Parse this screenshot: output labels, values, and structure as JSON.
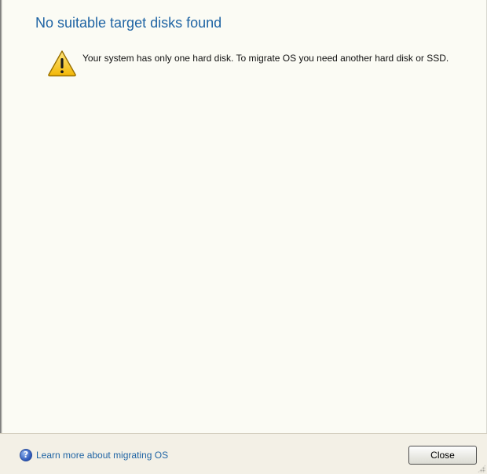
{
  "dialog": {
    "title": "No suitable target disks found",
    "message": "Your system has only one hard disk. To migrate OS you need another hard disk or SSD.",
    "icon": "warning-icon"
  },
  "footer": {
    "help_link_label": "Learn more about migrating OS",
    "help_icon": "question-circle-icon",
    "close_label": "Close"
  },
  "colors": {
    "background": "#fbfbf4",
    "title": "#1f64a4",
    "link": "#1f64a4",
    "warning_fill": "#f7c51e"
  }
}
